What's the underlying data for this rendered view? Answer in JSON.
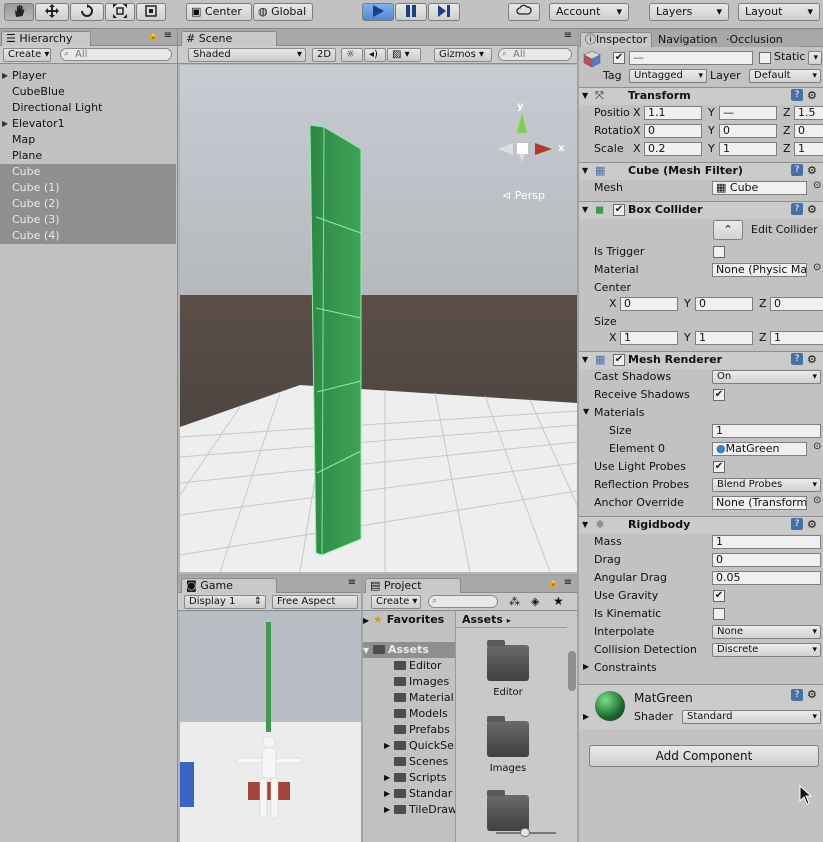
{
  "toolbar": {
    "tools": [
      "hand-tool-icon",
      "move-tool-icon",
      "rotate-tool-icon",
      "scale-tool-icon",
      "rect-tool-icon"
    ],
    "pivot_label": "Center",
    "space_label": "Global",
    "cloud_icon": "cloud-icon",
    "account_label": "Account",
    "layers_label": "Layers",
    "layout_label": "Layout"
  },
  "hierarchy": {
    "tab_label": "Hierarchy",
    "create_label": "Create",
    "search_placeholder": "All",
    "items": [
      {
        "label": "Player",
        "expand": true,
        "selected": false
      },
      {
        "label": "CubeBlue",
        "expand": false,
        "selected": false
      },
      {
        "label": "Directional Light",
        "expand": false,
        "selected": false
      },
      {
        "label": "Elevator1",
        "expand": true,
        "selected": false
      },
      {
        "label": "Map",
        "expand": false,
        "selected": false
      },
      {
        "label": "Plane",
        "expand": false,
        "selected": false
      },
      {
        "label": "Cube",
        "expand": false,
        "selected": true
      },
      {
        "label": "Cube (1)",
        "expand": false,
        "selected": true
      },
      {
        "label": "Cube (2)",
        "expand": false,
        "selected": true
      },
      {
        "label": "Cube (3)",
        "expand": false,
        "selected": true
      },
      {
        "label": "Cube (4)",
        "expand": false,
        "selected": true
      }
    ]
  },
  "scene": {
    "tab_label": "Scene",
    "shading_label": "Shaded",
    "mode_2d": "2D",
    "gizmos_label": "Gizmos",
    "search_placeholder": "All",
    "gizmo_y": "y",
    "gizmo_x": "x",
    "persp_label": "Persp"
  },
  "game": {
    "tab_label": "Game",
    "display_label": "Display 1",
    "aspect_label": "Free Aspect"
  },
  "project": {
    "tab_label": "Project",
    "create_label": "Create",
    "favorites_label": "Favorites",
    "assets_label": "Assets",
    "breadcrumb": "Assets",
    "folders": [
      "Editor",
      "Images",
      "Material",
      "Models",
      "Prefabs",
      "QuickSe",
      "Scenes",
      "Scripts",
      "Standar",
      "TileDraw"
    ],
    "folder_expand": [
      false,
      false,
      false,
      false,
      false,
      true,
      false,
      true,
      true,
      true
    ],
    "asset_items": [
      "Editor",
      "Images",
      ""
    ]
  },
  "inspector": {
    "tabs": [
      "Inspector",
      "Navigation",
      "Occlusion"
    ],
    "name_value": "—",
    "static_label": "Static",
    "tag_label": "Tag",
    "tag_value": "Untagged",
    "layer_label": "Layer",
    "layer_value": "Default",
    "transform": {
      "title": "Transform",
      "rows": [
        {
          "label": "Positio",
          "x": "1.1",
          "y": "—",
          "z": "1.5"
        },
        {
          "label": "Rotatio",
          "x": "0",
          "y": "0",
          "z": "0"
        },
        {
          "label": "Scale",
          "x": "0.2",
          "y": "1",
          "z": "1"
        }
      ]
    },
    "mesh_filter": {
      "title": "Cube (Mesh Filter)",
      "mesh_label": "Mesh",
      "mesh_value": "Cube"
    },
    "box_collider": {
      "title": "Box Collider",
      "edit_label": "Edit Collider",
      "is_trigger_label": "Is Trigger",
      "material_label": "Material",
      "material_value": "None (Physic Ma",
      "center_label": "Center",
      "center": {
        "x": "0",
        "y": "0",
        "z": "0"
      },
      "size_label": "Size",
      "size": {
        "x": "1",
        "y": "1",
        "z": "1"
      }
    },
    "mesh_renderer": {
      "title": "Mesh Renderer",
      "rows": [
        {
          "label": "Cast Shadows",
          "value": "On"
        },
        {
          "label": "Receive Shadows",
          "value": ""
        },
        {
          "label": "Materials",
          "value": ""
        }
      ],
      "size_label": "Size",
      "size_value": "1",
      "element0_label": "Element 0",
      "element0_value": "MatGreen",
      "light_probes_label": "Use Light Probes",
      "reflection_label": "Reflection Probes",
      "reflection_value": "Blend Probes",
      "anchor_label": "Anchor Override",
      "anchor_value": "None (Transform"
    },
    "rigidbody": {
      "title": "Rigidbody",
      "mass_label": "Mass",
      "mass": "1",
      "drag_label": "Drag",
      "drag": "0",
      "angular_label": "Angular Drag",
      "angular": "0.05",
      "gravity_label": "Use Gravity",
      "kinematic_label": "Is Kinematic",
      "interpolate_label": "Interpolate",
      "interpolate": "None",
      "collision_label": "Collision Detection",
      "collision": "Discrete",
      "constraints_label": "Constraints"
    },
    "material": {
      "name": "MatGreen",
      "shader_label": "Shader",
      "shader_value": "Standard"
    },
    "add_component_label": "Add Component",
    "axis": {
      "x": "X",
      "y": "Y",
      "z": "Z"
    }
  },
  "colors": {
    "accent": "#3a78d1",
    "green": "#3f9a52",
    "selection": "#8f8f8f"
  }
}
